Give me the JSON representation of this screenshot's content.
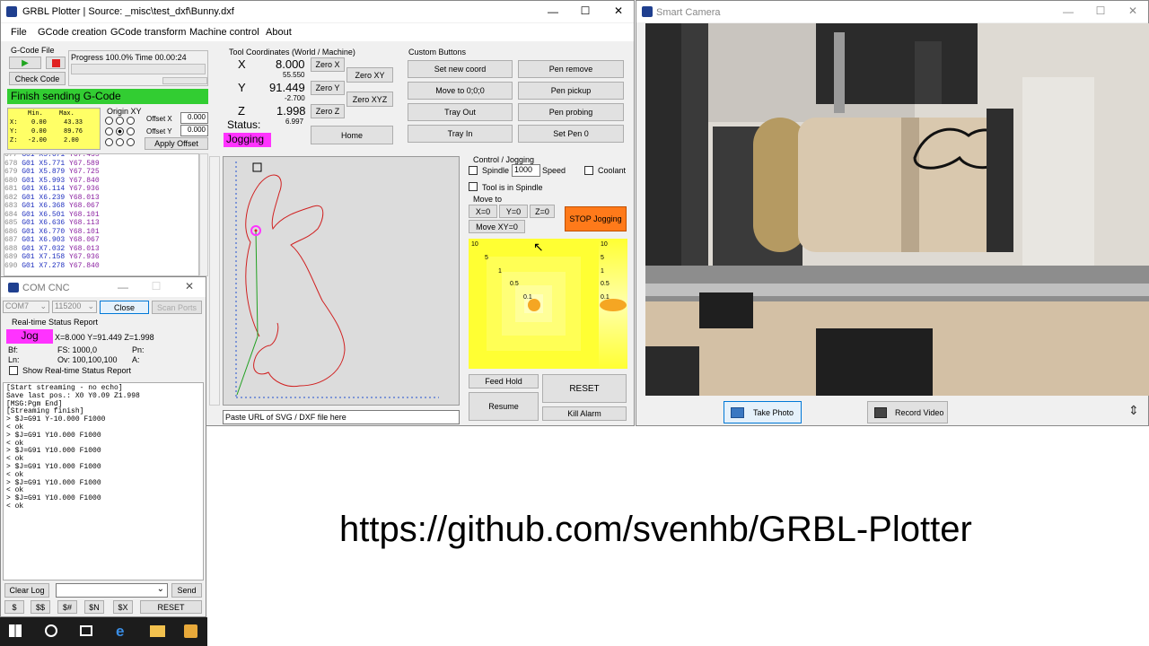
{
  "main_window": {
    "title": "GRBL Plotter | Source: _misc\\test_dxf\\Bunny.dxf",
    "minimize": "—",
    "maximize": "☐",
    "close": "✕",
    "menu": [
      "File",
      "GCode creation",
      "GCode transform",
      "Machine control",
      "About"
    ]
  },
  "gcode_file": {
    "label": "G-Code File",
    "check_code": "Check Code",
    "progress": "Progress 100.0% Time 00.00:24",
    "progress_fraction": 1.0,
    "status_banner": "Finish sending G-Code"
  },
  "minmax": {
    "header_min": "Min.",
    "header_max": "Max.",
    "rows": [
      {
        "axis": "X:",
        "min": "0.00",
        "max": "43.33"
      },
      {
        "axis": "Y:",
        "min": "0.00",
        "max": "89.76"
      },
      {
        "axis": "Z:",
        "min": "-2.00",
        "max": "2.00"
      }
    ]
  },
  "origin": {
    "label": "Origin XY",
    "offset_x_label": "Offset X",
    "offset_x": "0.000",
    "offset_y_label": "Offset Y",
    "offset_y": "0.000",
    "apply": "Apply Offset"
  },
  "gcode_lines": [
    {
      "n": "677",
      "cmd": "G01",
      "x": "X5.671",
      "y": "Y67.435"
    },
    {
      "n": "678",
      "cmd": "G01",
      "x": "X5.771",
      "y": "Y67.589"
    },
    {
      "n": "679",
      "cmd": "G01",
      "x": "X5.879",
      "y": "Y67.725"
    },
    {
      "n": "680",
      "cmd": "G01",
      "x": "X5.993",
      "y": "Y67.840"
    },
    {
      "n": "681",
      "cmd": "G01",
      "x": "X6.114",
      "y": "Y67.936"
    },
    {
      "n": "682",
      "cmd": "G01",
      "x": "X6.239",
      "y": "Y68.013"
    },
    {
      "n": "683",
      "cmd": "G01",
      "x": "X6.368",
      "y": "Y68.067"
    },
    {
      "n": "684",
      "cmd": "G01",
      "x": "X6.501",
      "y": "Y68.101"
    },
    {
      "n": "685",
      "cmd": "G01",
      "x": "X6.636",
      "y": "Y68.113"
    },
    {
      "n": "686",
      "cmd": "G01",
      "x": "X6.770",
      "y": "Y68.101"
    },
    {
      "n": "687",
      "cmd": "G01",
      "x": "X6.903",
      "y": "Y68.067"
    },
    {
      "n": "688",
      "cmd": "G01",
      "x": "X7.032",
      "y": "Y68.013"
    },
    {
      "n": "689",
      "cmd": "G01",
      "x": "X7.158",
      "y": "Y67.936"
    },
    {
      "n": "690",
      "cmd": "G01",
      "x": "X7.278",
      "y": "Y67.840"
    }
  ],
  "tool_coords": {
    "label": "Tool Coordinates (World / Machine)",
    "x_label": "X",
    "x_world": "8.000",
    "x_machine": "55.550",
    "y_label": "Y",
    "y_world": "91.449",
    "y_machine": "-2.700",
    "z_label": "Z",
    "z_world": "1.998",
    "z_machine": "6.997",
    "zero_x": "Zero X",
    "zero_y": "Zero Y",
    "zero_z": "Zero Z",
    "zero_xy": "Zero XY",
    "zero_xyz": "Zero XYZ",
    "status_label": "Status:",
    "status_value": "Jogging",
    "home": "Home"
  },
  "custom_buttons": {
    "label": "Custom Buttons",
    "items": [
      "Set new coord",
      "Pen remove",
      "Move to 0;0;0",
      "Pen pickup",
      "Tray Out",
      "Pen probing",
      "Tray In",
      "Set Pen 0"
    ]
  },
  "control": {
    "label": "Control / Jogging",
    "spindle": "Spindle",
    "speed_value": "1000",
    "speed_label": "Speed",
    "coolant": "Coolant",
    "tool_in_spindle": "Tool is in Spindle",
    "move_to": "Move to",
    "x0": "X=0",
    "y0": "Y=0",
    "z0": "Z=0",
    "move_xy0": "Move XY=0",
    "stop_jogging": "STOP Jogging",
    "jog_xy_labels": [
      "10",
      "5",
      "1",
      "0.5",
      "0.1"
    ],
    "jog_z_labels": [
      "10",
      "5",
      "1",
      "0.5",
      "0.1"
    ],
    "feed_hold": "Feed Hold",
    "reset": "RESET",
    "resume": "Resume",
    "kill_alarm": "Kill Alarm"
  },
  "url_input": {
    "placeholder": "Paste URL of SVG / DXF file here"
  },
  "com": {
    "title": "COM CNC",
    "minimize": "—",
    "maximize": "☐",
    "close": "✕",
    "port": "COM7",
    "baud": "115200",
    "close_btn": "Close",
    "scan_ports": "Scan Ports",
    "realtime_label": "Real-time Status Report",
    "state": "Jog",
    "position": "X=8.000 Y=91.449 Z=1.998",
    "bf": "Bf:",
    "fs": "FS:  1000,0",
    "pn": "Pn:",
    "ln": "Ln:",
    "ov": "Ov:  100,100,100",
    "a": "A:",
    "show_report": "Show Real-time Status Report",
    "log": [
      "[Start streaming - no echo]",
      "Save last pos.: X0 Y0.09 Z1.998",
      "[MSG:Pgm End]",
      "[Streaming finish]",
      "> $J=G91 Y-10.000 F1000",
      "< ok",
      "> $J=G91 Y10.000 F1000",
      "< ok",
      "> $J=G91 Y10.000 F1000",
      "< ok",
      "> $J=G91 Y10.000 F1000",
      "< ok",
      "> $J=G91 Y10.000 F1000",
      "< ok",
      "> $J=G91 Y10.000 F1000",
      "< ok"
    ],
    "clear_log": "Clear Log",
    "send": "Send",
    "quick": [
      "$",
      "$$",
      "$#",
      "$N",
      "$X"
    ],
    "reset": "RESET"
  },
  "camera": {
    "title": "Smart Camera",
    "minimize": "—",
    "maximize": "☐",
    "close": "✕",
    "take_photo": "Take Photo",
    "record_video": "Record Video"
  },
  "url_banner": "https://github.com/svenhb/GRBL-Plotter",
  "colors": {
    "accent_green": "#32cd32",
    "jog_magenta": "#ff33ff",
    "stop_orange": "#ff7a1a",
    "jog_yellow": "#ffff33",
    "path_red": "#d02020"
  }
}
